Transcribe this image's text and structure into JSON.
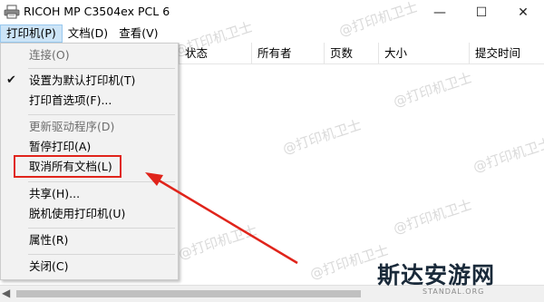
{
  "window": {
    "title": "RICOH MP C3504ex PCL 6",
    "app_icon": "printer-icon",
    "controls": {
      "minimize": "—",
      "maximize": "☐",
      "close": "✕"
    }
  },
  "menubar": {
    "items": [
      {
        "label": "打印机(P)",
        "active": true
      },
      {
        "label": "文档(D)",
        "active": false
      },
      {
        "label": "查看(V)",
        "active": false
      }
    ]
  },
  "columns": [
    "状态",
    "所有者",
    "页数",
    "大小",
    "提交时间"
  ],
  "dropdown": {
    "items": [
      {
        "label": "连接(O)",
        "disabled": true
      },
      {
        "label": "设置为默认打印机(T)",
        "checked": true
      },
      {
        "label": "打印首选项(F)..."
      },
      {
        "label": "更新驱动程序(D)",
        "disabled": true
      },
      {
        "label": "暂停打印(A)"
      },
      {
        "label": "取消所有文档(L)",
        "highlighted": true
      },
      {
        "label": "共享(H)..."
      },
      {
        "label": "脱机使用打印机(U)"
      },
      {
        "label": "属性(R)"
      },
      {
        "label": "关闭(C)"
      }
    ]
  },
  "annotation": {
    "color": "#e0241b"
  },
  "watermark": {
    "text": "@打印机卫士"
  },
  "logo": {
    "main": "斯达安游网",
    "sub": "STANDAL.ORG"
  }
}
